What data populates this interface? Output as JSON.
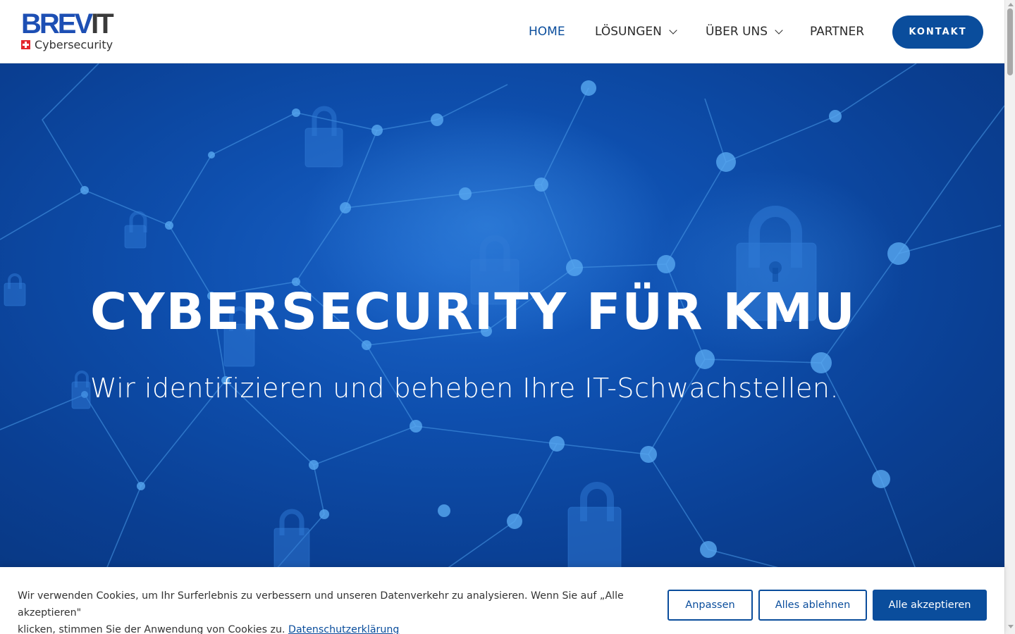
{
  "header": {
    "logo": {
      "word_part1": "BREV",
      "word_part2": "IT",
      "subtitle": "Cybersecurity"
    },
    "nav": [
      {
        "label": "HOME",
        "active": true,
        "has_dropdown": false
      },
      {
        "label": "LÖSUNGEN",
        "active": false,
        "has_dropdown": true
      },
      {
        "label": "ÜBER UNS",
        "active": false,
        "has_dropdown": true
      },
      {
        "label": "PARTNER",
        "active": false,
        "has_dropdown": false
      }
    ],
    "cta_label": "KONTAKT"
  },
  "hero": {
    "title": "CYBERSECURITY FÜR KMU",
    "subtitle": "Wir identifizieren und beheben Ihre IT-Schwachstellen."
  },
  "cookie_banner": {
    "text_line1": "Wir verwenden Cookies, um Ihr Surferlebnis zu verbessern und unseren Datenverkehr zu analysieren. Wenn Sie auf „Alle akzeptieren\"",
    "text_line2": "klicken, stimmen Sie der Anwendung von Cookies zu.",
    "link_label": "Datenschutzerklärung",
    "buttons": {
      "customize": "Anpassen",
      "reject_all": "Alles ablehnen",
      "accept_all": "Alle akzeptieren"
    }
  },
  "colors": {
    "brand_blue": "#0a4d9c",
    "logo_blue": "#1d4fb4",
    "hero_blue": "#0e4fae",
    "swiss_red": "#e3262c"
  },
  "icons": [
    "swiss-flag-icon",
    "chevron-down-icon",
    "padlock-icon"
  ]
}
